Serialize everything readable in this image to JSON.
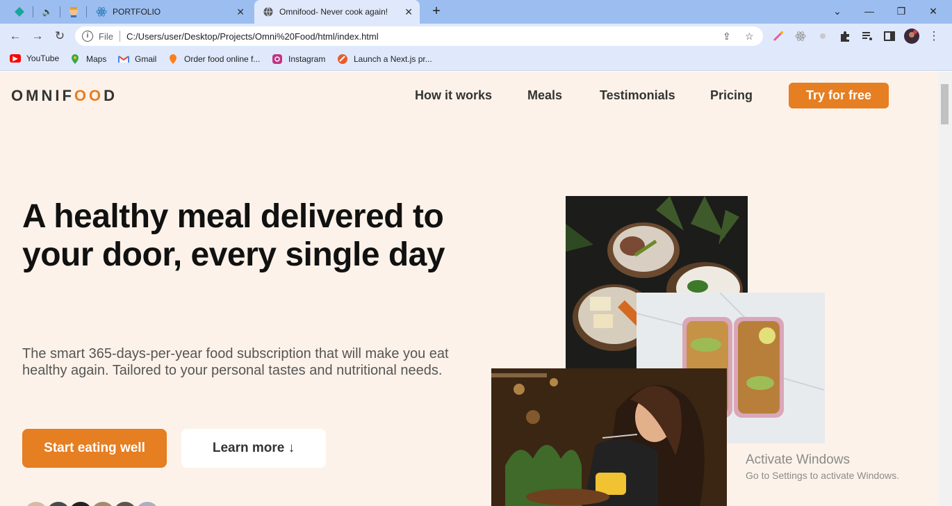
{
  "browser": {
    "tabs": [
      {
        "title": "PORTFOLIO"
      },
      {
        "title": "Omnifood- Never cook again!"
      }
    ],
    "new_tab_label": "+",
    "window_controls": {
      "minimize": "—",
      "restore": "❐",
      "close": "✕"
    },
    "address": {
      "scheme_label": "File",
      "url": "C:/Users/user/Desktop/Projects/Omni%20Food/html/index.html"
    },
    "bookmarks": [
      {
        "label": "YouTube",
        "icon": "youtube-icon",
        "color": "#ff0000"
      },
      {
        "label": "Maps",
        "icon": "maps-icon",
        "color": "#34a853"
      },
      {
        "label": "Gmail",
        "icon": "gmail-icon",
        "color": "#ea4335"
      },
      {
        "label": "Order food online f...",
        "icon": "swiggy-icon",
        "color": "#fc8019"
      },
      {
        "label": "Instagram",
        "icon": "instagram-icon",
        "color": "#c13584"
      },
      {
        "label": "Launch a Next.js pr...",
        "icon": "next-icon",
        "color": "#e85d2a"
      }
    ]
  },
  "site": {
    "logo_prefix": "OMNIF",
    "logo_oo": "OO",
    "logo_suffix": "D",
    "nav": [
      "How it works",
      "Meals",
      "Testimonials",
      "Pricing"
    ],
    "cta": "Try for free",
    "hero_title": "A healthy meal delivered to your door, every single day",
    "hero_description": "The smart 365-days-per-year food subscription that will make you eat healthy again. Tailored to your personal tastes and nutritional needs.",
    "primary_button": "Start eating well",
    "secondary_button": "Learn more ↓",
    "accent_color": "#e67e22",
    "background_color": "#fdf2e9"
  },
  "os_watermark": {
    "line1": "Activate Windows",
    "line2": "Go to Settings to activate Windows."
  }
}
